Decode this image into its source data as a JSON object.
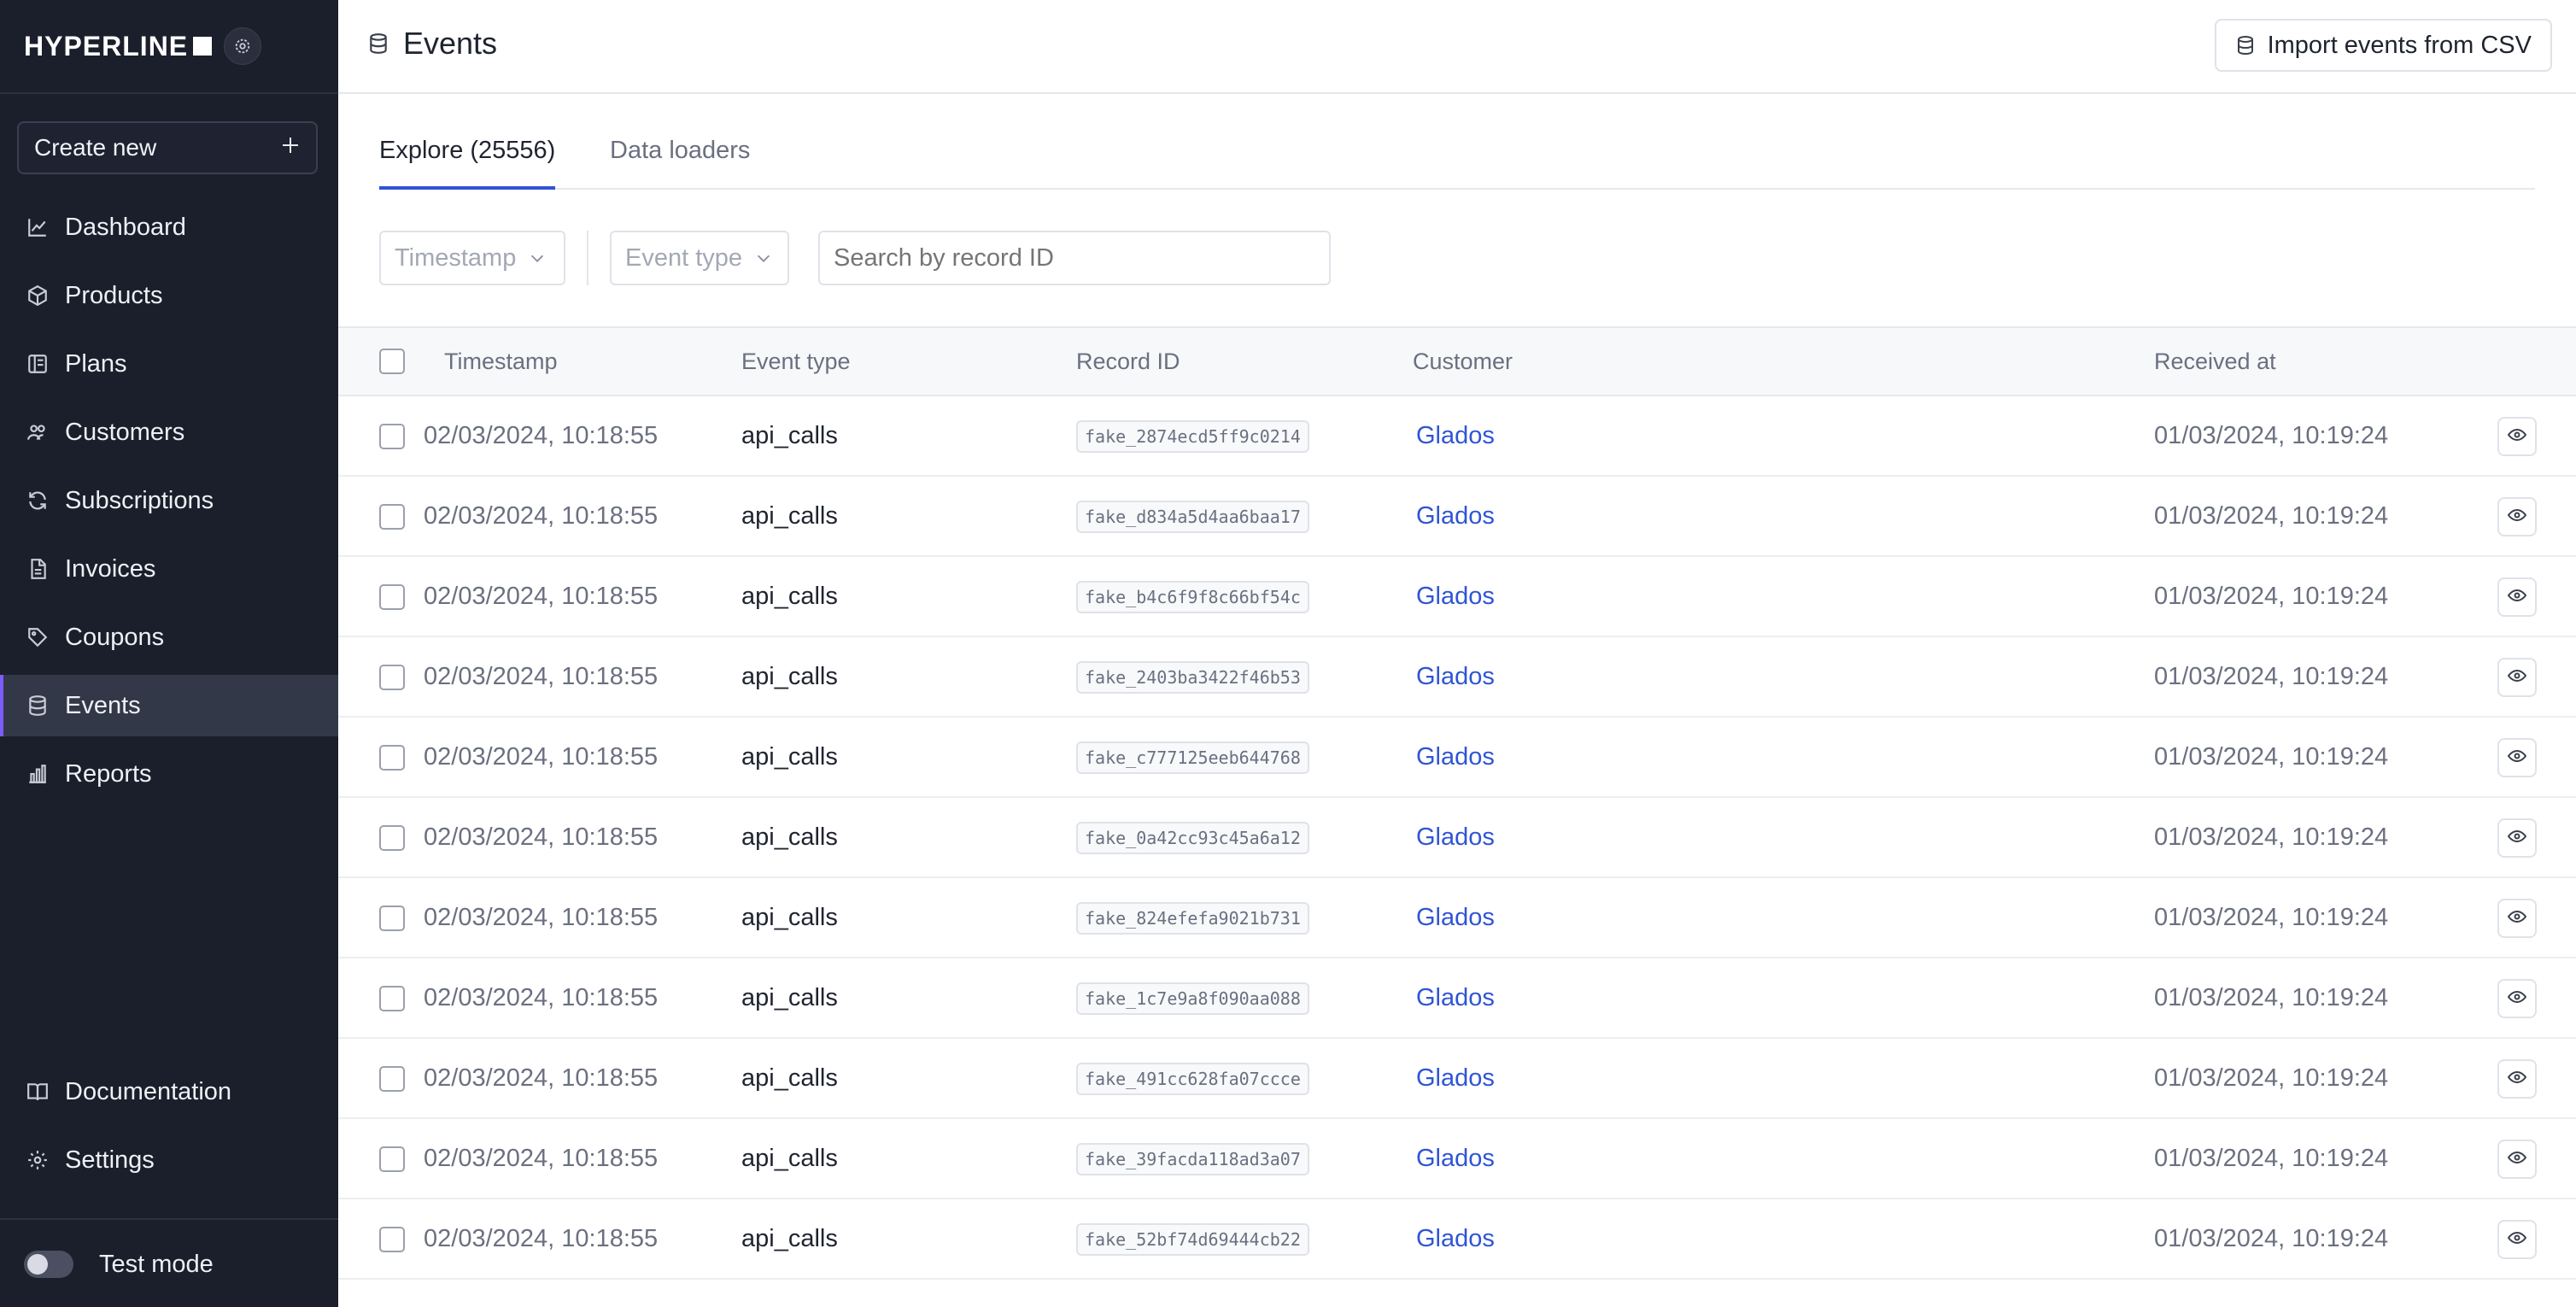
{
  "brand": {
    "name": "HYPERLINE"
  },
  "sidebar": {
    "create_label": "Create new",
    "items": [
      {
        "label": "Dashboard",
        "icon": "chart-line-icon"
      },
      {
        "label": "Products",
        "icon": "cube-icon"
      },
      {
        "label": "Plans",
        "icon": "plans-icon"
      },
      {
        "label": "Customers",
        "icon": "users-icon"
      },
      {
        "label": "Subscriptions",
        "icon": "refresh-icon"
      },
      {
        "label": "Invoices",
        "icon": "file-icon"
      },
      {
        "label": "Coupons",
        "icon": "tag-icon"
      },
      {
        "label": "Events",
        "icon": "database-icon",
        "active": true
      },
      {
        "label": "Reports",
        "icon": "bar-chart-icon"
      }
    ],
    "bottom_items": [
      {
        "label": "Documentation",
        "icon": "book-icon"
      },
      {
        "label": "Settings",
        "icon": "gear-icon"
      }
    ],
    "test_mode_label": "Test mode",
    "test_mode_on": false
  },
  "header": {
    "title": "Events",
    "import_label": "Import events from CSV"
  },
  "tabs": [
    {
      "label": "Explore (25556)",
      "active": true
    },
    {
      "label": "Data loaders",
      "active": false
    }
  ],
  "filters": {
    "timestamp_label": "Timestamp",
    "event_type_label": "Event type",
    "search_placeholder": "Search by record ID"
  },
  "table": {
    "columns": [
      "Timestamp",
      "Event type",
      "Record ID",
      "Customer",
      "Received at"
    ],
    "rows": [
      {
        "timestamp": "02/03/2024, 10:18:55",
        "event_type": "api_calls",
        "record_id": "fake_2874ecd5ff9c0214",
        "customer": "Glados",
        "received_at": "01/03/2024, 10:19:24"
      },
      {
        "timestamp": "02/03/2024, 10:18:55",
        "event_type": "api_calls",
        "record_id": "fake_d834a5d4aa6baa17",
        "customer": "Glados",
        "received_at": "01/03/2024, 10:19:24"
      },
      {
        "timestamp": "02/03/2024, 10:18:55",
        "event_type": "api_calls",
        "record_id": "fake_b4c6f9f8c66bf54c",
        "customer": "Glados",
        "received_at": "01/03/2024, 10:19:24"
      },
      {
        "timestamp": "02/03/2024, 10:18:55",
        "event_type": "api_calls",
        "record_id": "fake_2403ba3422f46b53",
        "customer": "Glados",
        "received_at": "01/03/2024, 10:19:24"
      },
      {
        "timestamp": "02/03/2024, 10:18:55",
        "event_type": "api_calls",
        "record_id": "fake_c777125eeb644768",
        "customer": "Glados",
        "received_at": "01/03/2024, 10:19:24"
      },
      {
        "timestamp": "02/03/2024, 10:18:55",
        "event_type": "api_calls",
        "record_id": "fake_0a42cc93c45a6a12",
        "customer": "Glados",
        "received_at": "01/03/2024, 10:19:24"
      },
      {
        "timestamp": "02/03/2024, 10:18:55",
        "event_type": "api_calls",
        "record_id": "fake_824efefa9021b731",
        "customer": "Glados",
        "received_at": "01/03/2024, 10:19:24"
      },
      {
        "timestamp": "02/03/2024, 10:18:55",
        "event_type": "api_calls",
        "record_id": "fake_1c7e9a8f090aa088",
        "customer": "Glados",
        "received_at": "01/03/2024, 10:19:24"
      },
      {
        "timestamp": "02/03/2024, 10:18:55",
        "event_type": "api_calls",
        "record_id": "fake_491cc628fa07ccce",
        "customer": "Glados",
        "received_at": "01/03/2024, 10:19:24"
      },
      {
        "timestamp": "02/03/2024, 10:18:55",
        "event_type": "api_calls",
        "record_id": "fake_39facda118ad3a07",
        "customer": "Glados",
        "received_at": "01/03/2024, 10:19:24"
      },
      {
        "timestamp": "02/03/2024, 10:18:55",
        "event_type": "api_calls",
        "record_id": "fake_52bf74d69444cb22",
        "customer": "Glados",
        "received_at": "01/03/2024, 10:19:24"
      }
    ]
  },
  "colors": {
    "sidebar_bg": "#1b1f2b",
    "accent": "#2f55d4",
    "active_marker": "#7c5cff"
  }
}
